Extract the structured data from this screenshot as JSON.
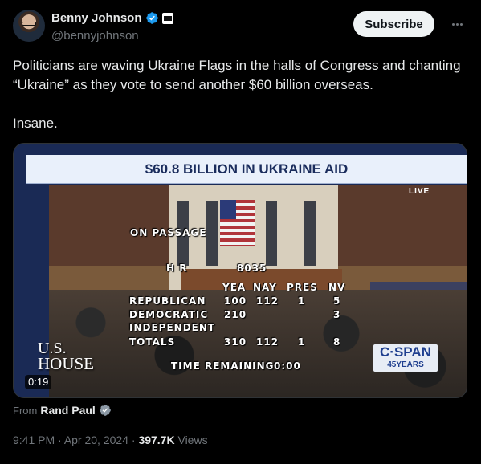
{
  "author": {
    "display_name": "Benny Johnson",
    "handle": "@bennyjohnson"
  },
  "actions": {
    "subscribe_label": "Subscribe"
  },
  "tweet": {
    "text": "Politicians are waving Ukraine Flags in the halls of Congress and chanting “Ukraine” as they vote to send another $60 billion overseas.",
    "text2": "Insane."
  },
  "video": {
    "banner": "$60.8 BILLION IN UKRAINE AID",
    "live": "LIVE",
    "on_passage": "ON PASSAGE",
    "hr_label": "H R",
    "hr_number": "8035",
    "head_yea": "YEA",
    "head_nay": "NAY",
    "head_pres": "PRES",
    "head_nv": "NV",
    "rows": [
      {
        "party": "REPUBLICAN",
        "yea": "100",
        "nay": "112",
        "pres": "1",
        "nv": "5"
      },
      {
        "party": "DEMOCRATIC",
        "yea": "210",
        "nay": "",
        "pres": "",
        "nv": "3"
      },
      {
        "party": "INDEPENDENT",
        "yea": "",
        "nay": "",
        "pres": "",
        "nv": ""
      },
      {
        "party": "TOTALS",
        "yea": "310",
        "nay": "112",
        "pres": "1",
        "nv": "8"
      }
    ],
    "time_remaining_label": "TIME REMAINING",
    "time_remaining_value": "0:00",
    "logo_line1": "U.S.",
    "logo_line2": "HOUSE",
    "cspan_line1": "C·SPAN",
    "cspan_line2": "45YEARS",
    "duration": "0:19"
  },
  "source": {
    "prefix": "From",
    "name": "Rand Paul"
  },
  "meta": {
    "time": "9:41 PM",
    "date": "Apr 20, 2024",
    "views_count": "397.7K",
    "views_label": "Views"
  },
  "colors": {
    "verified": "#1d9bf0",
    "background": "#000000",
    "banner": "#e9f0fb"
  }
}
